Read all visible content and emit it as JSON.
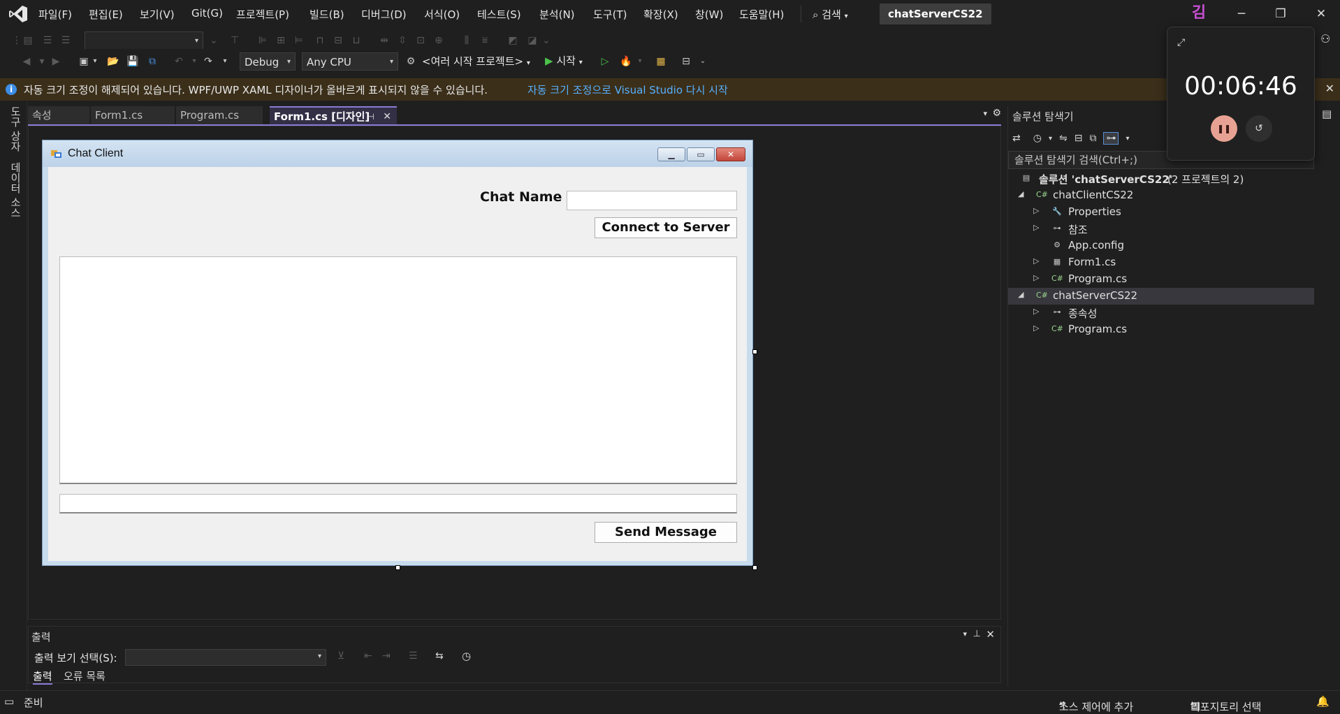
{
  "menu": {
    "items": [
      "파일(F)",
      "편집(E)",
      "보기(V)",
      "Git(G)",
      "프로젝트(P)",
      "빌드(B)",
      "디버그(D)",
      "서식(O)",
      "테스트(S)",
      "분석(N)",
      "도구(T)",
      "확장(X)",
      "창(W)",
      "도움말(H)"
    ],
    "search_label": "검색",
    "solution_name": "chatServerCS22",
    "avatar_letter": "김"
  },
  "toolbar": {
    "config": "Debug",
    "platform": "Any CPU",
    "startup": "<여러 시작 프로젝트>",
    "start_label": "시작"
  },
  "infobar": {
    "message": "자동 크기 조정이 해제되어 있습니다. WPF/UWP XAML 디자이너가 올바르게 표시되지 않을 수 있습니다.",
    "link": "자동 크기 조정으로 Visual Studio 다시 시작"
  },
  "left_strip": [
    "도구 상자",
    "데이터 소스"
  ],
  "tabs": [
    "속성",
    "Form1.cs",
    "Program.cs",
    "Form1.cs [디자인]"
  ],
  "form": {
    "title": "Chat Client",
    "chat_name_label": "Chat Name",
    "connect_button": "Connect to Server",
    "send_button": "Send Message"
  },
  "output": {
    "title": "출력",
    "select_label": "출력 보기 선택(S):",
    "tabs": [
      "출력",
      "오류 목록"
    ]
  },
  "solution_explorer": {
    "title": "솔루션 탐색기",
    "search_placeholder": "솔루션 탐색기 검색(Ctrl+;)",
    "solution_label": "솔루션 'chatServerCS22'",
    "solution_count": "(2 프로젝트의 2)",
    "tree": [
      {
        "label": "chatClientCS22",
        "icon": "csharp-project-icon"
      },
      {
        "label": "Properties",
        "icon": "wrench-icon"
      },
      {
        "label": "참조",
        "icon": "references-icon"
      },
      {
        "label": "App.config",
        "icon": "config-file-icon"
      },
      {
        "label": "Form1.cs",
        "icon": "form-icon"
      },
      {
        "label": "Program.cs",
        "icon": "csharp-file-icon"
      },
      {
        "label": "chatServerCS22",
        "icon": "csharp-project-icon"
      },
      {
        "label": "종속성",
        "icon": "dependencies-icon"
      },
      {
        "label": "Program.cs",
        "icon": "csharp-file-icon"
      }
    ]
  },
  "timer": {
    "time": "00:06:46"
  },
  "status": {
    "ready": "준비",
    "source_control": "소스 제어에 추가",
    "repo": "리포지토리 선택"
  },
  "colors": {
    "accent": "#8a7cd6",
    "infobar_bg": "#3b2f1a",
    "link": "#58b0ff",
    "timer_pause": "#e8a293"
  }
}
